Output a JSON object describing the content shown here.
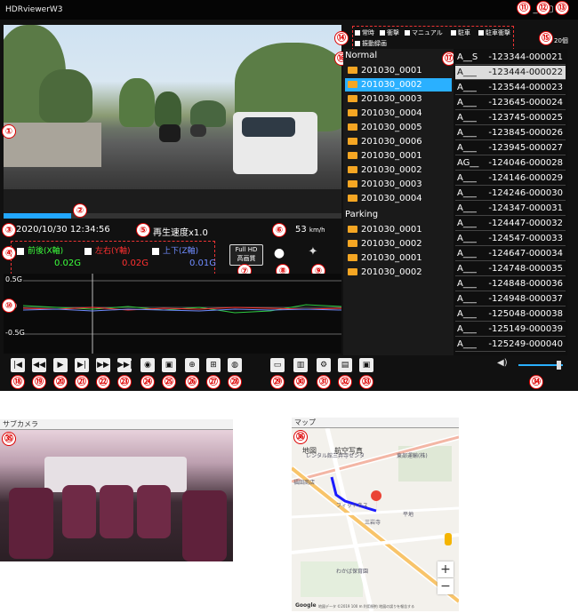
{
  "app": {
    "title": "HDRviewerW3",
    "win_buttons": [
      "_",
      "▢",
      "✕"
    ]
  },
  "callouts": [
    "①",
    "②",
    "③",
    "④",
    "⑤",
    "⑥",
    "⑦",
    "⑧",
    "⑨",
    "⑩",
    "⑪",
    "⑫",
    "⑬",
    "⑭",
    "⑮",
    "⑯",
    "⑰",
    "⑱",
    "⑲",
    "⑳",
    "㉑",
    "㉒",
    "㉓",
    "㉔",
    "㉕",
    "㉖",
    "㉗",
    "㉘",
    "㉙",
    "㉚",
    "㉛",
    "㉜",
    "㉝",
    "㉞",
    "㉟",
    "㊱"
  ],
  "player": {
    "progress_fraction": 0.2,
    "datetime": "2020/10/30 12:34:56",
    "playback_speed": "再生速度x1.0",
    "speed_value": "53",
    "speed_unit": "km/h",
    "quality_line1": "Full HD",
    "quality_line2": "高画質"
  },
  "gsensor": {
    "front": {
      "label": "前後(X軸)",
      "value": "0.02G",
      "color": "#3cff3c"
    },
    "left": {
      "label": "左右(Y軸)",
      "value": "0.02G",
      "color": "#ff3030"
    },
    "up": {
      "label": "上下(Z軸)",
      "value": "0.01G",
      "color": "#6f8cff"
    }
  },
  "graph": {
    "ytick_top": "0.5G",
    "ytick_mid": "0",
    "ytick_bottom": "-0.5G"
  },
  "filters": {
    "items": [
      "常時",
      "衝撃",
      "マニュアル",
      "駐車",
      "駐車衝撃",
      "振動録画"
    ],
    "file_count": "20個"
  },
  "files": {
    "normal_header": "Normal",
    "parking_header": "Parking",
    "normal": [
      "201030_0001",
      "201030_0002",
      "201030_0003",
      "201030_0004",
      "201030_0005",
      "201030_0006",
      "201030_0001",
      "201030_0002",
      "201030_0003",
      "201030_0004"
    ],
    "parking": [
      "201030_0001",
      "201030_0002",
      "201030_0001",
      "201030_0002"
    ],
    "selected_index": 1
  },
  "ids": [
    {
      "a": "A__S",
      "d": "-123344-000021"
    },
    {
      "a": "A___",
      "d": "-123444-000022"
    },
    {
      "a": "A___",
      "d": "-123544-000023"
    },
    {
      "a": "A___",
      "d": "-123645-000024"
    },
    {
      "a": "A___",
      "d": "-123745-000025"
    },
    {
      "a": "A___",
      "d": "-123845-000026"
    },
    {
      "a": "A___",
      "d": "-123945-000027"
    },
    {
      "a": "AG__",
      "d": "-124046-000028"
    },
    {
      "a": "A___",
      "d": "-124146-000029"
    },
    {
      "a": "A___",
      "d": "-124246-000030"
    },
    {
      "a": "A___",
      "d": "-124347-000031"
    },
    {
      "a": "A___",
      "d": "-124447-000032"
    },
    {
      "a": "A___",
      "d": "-124547-000033"
    },
    {
      "a": "A___",
      "d": "-124647-000034"
    },
    {
      "a": "A___",
      "d": "-124748-000035"
    },
    {
      "a": "A___",
      "d": "-124848-000036"
    },
    {
      "a": "A___",
      "d": "-124948-000037"
    },
    {
      "a": "A___",
      "d": "-125048-000038"
    },
    {
      "a": "A___",
      "d": "-125149-000039"
    },
    {
      "a": "A___",
      "d": "-125249-000040"
    }
  ],
  "ids_selected_index": 1,
  "toolbar_icons": [
    "first-frame-icon",
    "rewind-icon",
    "play-icon",
    "step-forward-icon",
    "fast-forward-icon",
    "last-frame-icon",
    "camera-icon",
    "video-capture-icon",
    "zoom-icon",
    "split-icon",
    "globe-icon",
    "folder-icon",
    "trash-icon",
    "settings-icon",
    "csv-icon",
    "window-icon"
  ],
  "volume": {
    "level": 0.85
  },
  "subcam": {
    "title": "サブカメラ"
  },
  "map": {
    "title": "マップ",
    "tab_map": "地図",
    "tab_satellite": "航空写真",
    "zoom_in": "+",
    "zoom_out": "−",
    "labels": [
      "レンタル館三井寺センタ",
      "東部運輸(株)",
      "福田商店",
      "三岩寺",
      "フィットネス",
      "平地",
      "わかば保育園"
    ],
    "footer": "地図データ ©2019  100 m     利用規約  地図の誤りを報告する",
    "google": "Google"
  }
}
